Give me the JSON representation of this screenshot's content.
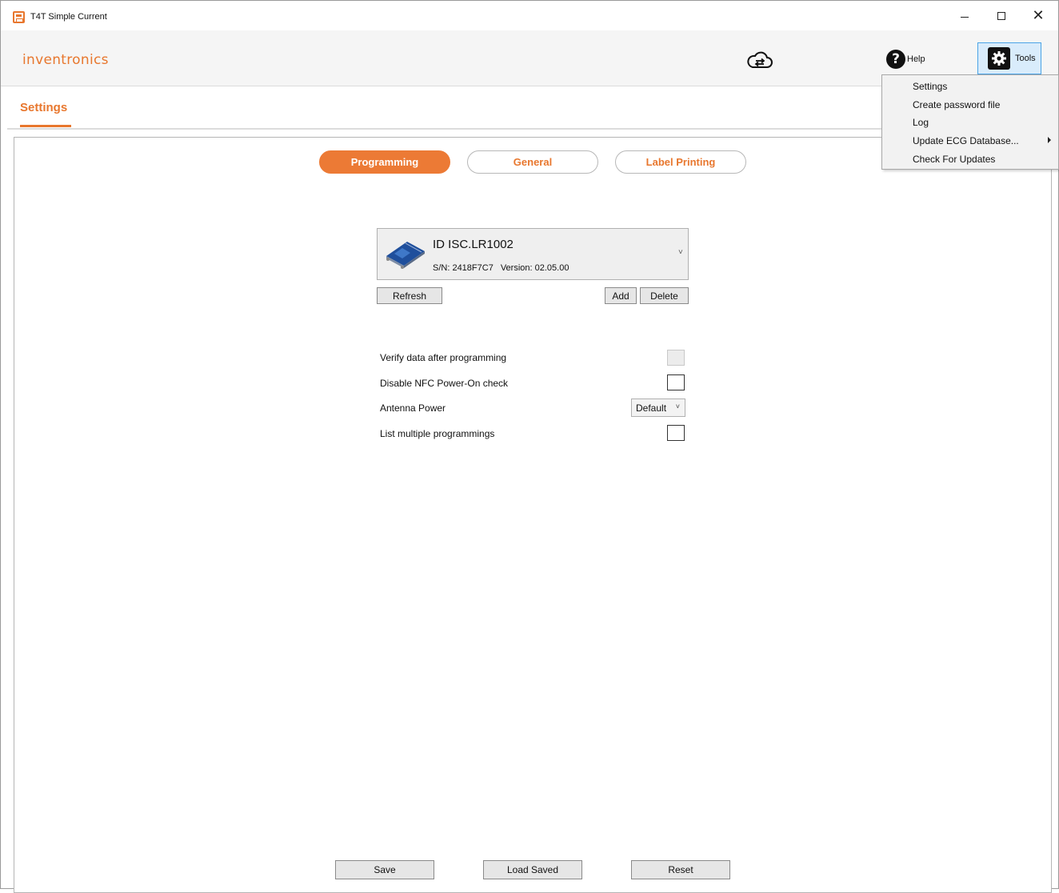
{
  "window": {
    "title": "T4T Simple Current",
    "app_icon": "app-logo-icon",
    "controls": {
      "minimize_icon": "minimize-icon",
      "maximize_icon": "maximize-icon",
      "close_icon": "close-icon",
      "close_glyph": "✕"
    }
  },
  "header": {
    "logo": "inventronics",
    "sync_icon": "cloud-sync-icon",
    "help": {
      "icon_glyph": "?",
      "label": "Help"
    },
    "tools": {
      "label": "Tools"
    }
  },
  "page": {
    "title": "Settings"
  },
  "tabs": [
    {
      "label": "Programming",
      "active": true
    },
    {
      "label": "General",
      "active": false
    },
    {
      "label": "Label Printing",
      "active": false
    }
  ],
  "device": {
    "name": "ID ISC.LR1002",
    "serial": "S/N: 2418F7C7",
    "version": "Version: 02.05.00",
    "chevron": "˅"
  },
  "device_buttons": {
    "refresh": "Refresh",
    "add": "Add",
    "delete": "Delete"
  },
  "options": {
    "verify_data": {
      "label": "Verify data after programming",
      "checked": false,
      "disabled": true
    },
    "disable_nfc": {
      "label": "Disable NFC Power-On check",
      "checked": false
    },
    "antenna_power": {
      "label": "Antenna Power",
      "value": "Default",
      "chevron": "˅"
    },
    "list_multiple": {
      "label": "List multiple programmings",
      "checked": false
    }
  },
  "footer": {
    "save": "Save",
    "load_saved": "Load Saved",
    "reset": "Reset"
  },
  "tools_menu": {
    "items": [
      {
        "label": "Settings"
      },
      {
        "label": "Create password file"
      },
      {
        "label": "Log"
      },
      {
        "label": "Update ECG Database...",
        "submenu": true
      },
      {
        "label": "Check For Updates"
      }
    ]
  },
  "colors": {
    "accent": "#e8772e",
    "tab_active": "#ec7a35",
    "tools_highlight": "#d9ecfb"
  }
}
